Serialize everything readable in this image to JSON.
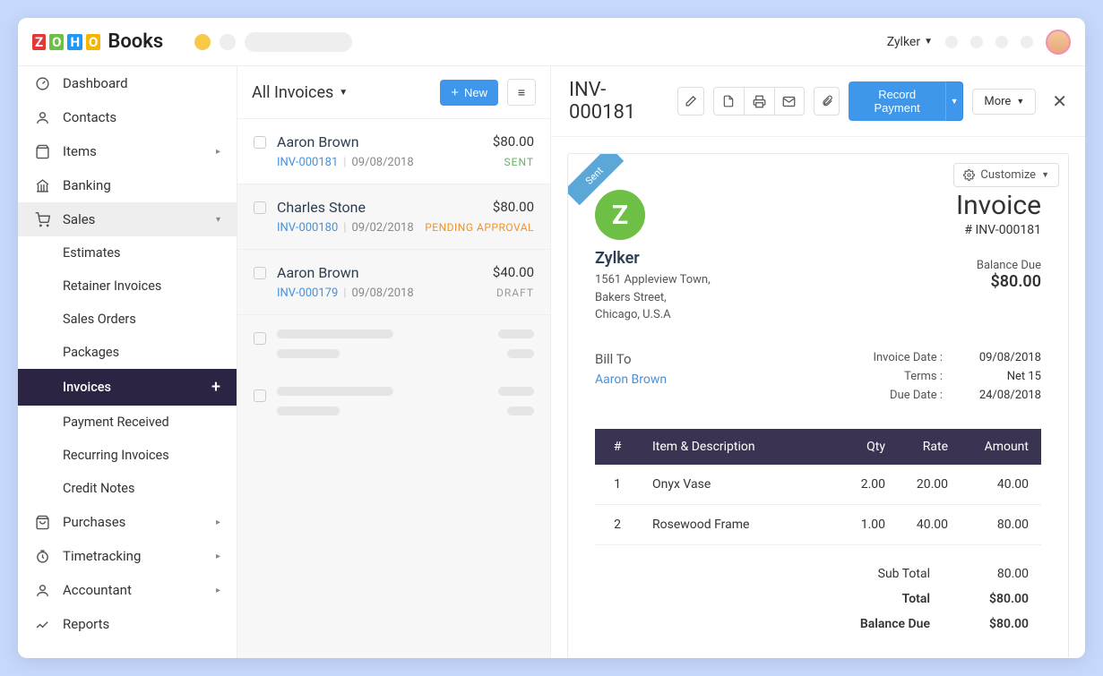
{
  "app": {
    "name": "Books",
    "org": "Zylker"
  },
  "sidebar": {
    "items": [
      {
        "label": "Dashboard"
      },
      {
        "label": "Contacts"
      },
      {
        "label": "Items"
      },
      {
        "label": "Banking"
      },
      {
        "label": "Sales"
      },
      {
        "label": "Purchases"
      },
      {
        "label": "Timetracking"
      },
      {
        "label": "Accountant"
      },
      {
        "label": "Reports"
      }
    ],
    "sales_sub": [
      {
        "label": "Estimates"
      },
      {
        "label": "Retainer Invoices"
      },
      {
        "label": "Sales Orders"
      },
      {
        "label": "Packages"
      },
      {
        "label": "Invoices"
      },
      {
        "label": "Payment Received"
      },
      {
        "label": "Recurring Invoices"
      },
      {
        "label": "Credit Notes"
      }
    ]
  },
  "list": {
    "title": "All Invoices",
    "new_label": "New",
    "rows": [
      {
        "customer": "Aaron Brown",
        "amount": "$80.00",
        "id": "INV-000181",
        "date": "09/08/2018",
        "status": "SENT",
        "status_class": "sent"
      },
      {
        "customer": "Charles Stone",
        "amount": "$80.00",
        "id": "INV-000180",
        "date": "09/02/2018",
        "status": "PENDING APPROVAL",
        "status_class": "pending"
      },
      {
        "customer": "Aaron Brown",
        "amount": "$40.00",
        "id": "INV-000179",
        "date": "09/08/2018",
        "status": "DRAFT",
        "status_class": "draft"
      }
    ]
  },
  "detail": {
    "title": "INV-000181",
    "record_payment": "Record Payment",
    "more": "More",
    "customize": "Customize",
    "ribbon": "Sent",
    "company": {
      "name": "Zylker",
      "addr1": "1561 Appleview Town,",
      "addr2": "Bakers Street,",
      "addr3": "Chicago, U.S.A"
    },
    "doc_title": "Invoice",
    "doc_number": "# INV-000181",
    "balance_due_label": "Balance Due",
    "balance_due": "$80.00",
    "bill_to_label": "Bill To",
    "bill_to_name": "Aaron Brown",
    "meta": {
      "invoice_date_k": "Invoice Date :",
      "invoice_date_v": "09/08/2018",
      "terms_k": "Terms :",
      "terms_v": "Net 15",
      "due_date_k": "Due Date :",
      "due_date_v": "24/08/2018"
    },
    "columns": {
      "num": "#",
      "desc": "Item & Description",
      "qty": "Qty",
      "rate": "Rate",
      "amount": "Amount"
    },
    "items": [
      {
        "n": "1",
        "desc": "Onyx Vase",
        "qty": "2.00",
        "rate": "20.00",
        "amount": "40.00"
      },
      {
        "n": "2",
        "desc": "Rosewood Frame",
        "qty": "1.00",
        "rate": "40.00",
        "amount": "80.00"
      }
    ],
    "totals": {
      "subtotal_k": "Sub Total",
      "subtotal_v": "80.00",
      "total_k": "Total",
      "total_v": "$80.00",
      "baldue_k": "Balance Due",
      "baldue_v": "$80.00"
    }
  }
}
